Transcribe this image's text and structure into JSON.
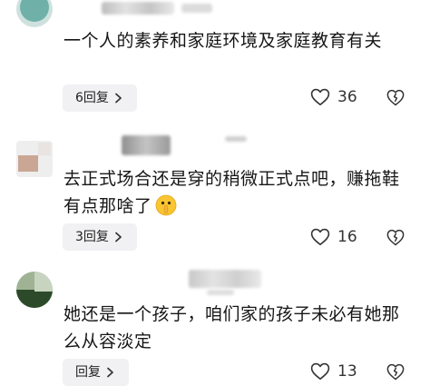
{
  "comments": [
    {
      "text": "一个人的素养和家庭环境及家庭教育有关",
      "reply_label": "6回复",
      "likes": "36",
      "avatar_colors": [
        "#6fb1a8",
        "#cfe1de"
      ],
      "icons": {
        "reply": "chevron-right-icon",
        "like": "heart-outline-icon",
        "dislike": "broken-heart-outline-icon"
      }
    },
    {
      "text": "去正式场合还是穿的稍微正式点吧，赚拖鞋有点那啥了",
      "emoji": "shushing-face-emoji",
      "reply_label": "3回复",
      "likes": "16",
      "avatar_colors": [
        "#c9a794",
        "#e9e4e1"
      ],
      "icons": {
        "reply": "chevron-right-icon",
        "like": "heart-outline-icon",
        "dislike": "broken-heart-outline-icon"
      }
    },
    {
      "text": "她还是一个孩子，咱们家的孩子未必有她那么从容淡定",
      "reply_label": "回复",
      "likes": "13",
      "avatar_colors": [
        "#2c4a2a",
        "#9fb394"
      ],
      "icons": {
        "reply": "chevron-right-icon",
        "like": "heart-outline-icon",
        "dislike": "broken-heart-outline-icon"
      }
    }
  ]
}
